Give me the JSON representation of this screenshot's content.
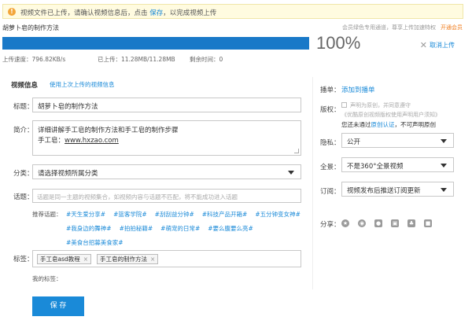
{
  "notice": {
    "prefix": "视频文件已上传，请确认视频信息后，点击",
    "save_link": "保存",
    "suffix": "，以完成视频上传"
  },
  "upload": {
    "file_name": "胡萝卜皂的制作方法",
    "vip_hint": "会员绿色专用通道，尊享上传加速特权",
    "vip_link": "开通会员",
    "progress": 100,
    "percent_label": "100%",
    "cancel_label": "取消上传",
    "speed_label": "上传速度：",
    "speed_value": "796.82KB/s",
    "uploaded_label": "已上传：",
    "uploaded_value": "11.28MB/11.28MB",
    "remaining_label": "剩余时间：",
    "remaining_value": "0"
  },
  "video_info": {
    "section_title": "视频信息",
    "last_info_link": "使用上次上传的视频信息",
    "title_label": "标题：",
    "title_value": "胡萝卜皂的制作方法",
    "desc_label": "简介：",
    "desc_line1": "详细讲解手工皂的制作方法和手工皂的制作步骤",
    "desc_line2_prefix": "手工皂：",
    "desc_line2_link": "www.hxzao.com",
    "category_label": "分类：",
    "category_value": "请选择视频所属分类",
    "topic_label": "话题：",
    "topic_placeholder": "话题是同一主题的视频集合，如视频内容与话题不匹配，将不能成功进入话题",
    "rec_label": "推荐话题：",
    "rec_topics_row1": [
      "#天生爱分享#",
      "#篮客学院#",
      "#刮刮益分钟#",
      "#科技产品开箱#",
      "#五分钟变女神#"
    ],
    "rec_topics_row2": [
      "#我身边的舞神#",
      "#拍拍秘籍#",
      "#萌宠的日常#",
      "#要么腹要么亮#"
    ],
    "rec_topics_row3": [
      "#美食台招募美食家#"
    ],
    "tags_label": "标签：",
    "tags": [
      "手工皂asd教程",
      "手工皂的制作方法"
    ],
    "my_tags_label": "我的标签：",
    "save_button": "保 存"
  },
  "side": {
    "playlist_label": "播单：",
    "playlist_link": "添加到播单",
    "copyright_label": "版权：",
    "copyright_check": "声明为原创，并同意遵守",
    "copyright_agreement": "《优酷原创视频版权使用声明用户须知》",
    "copyright_note_prefix": "您还未通过",
    "copyright_note_link": "原创认证",
    "copyright_note_suffix": "，不可声明原创",
    "privacy_label": "隐私：",
    "privacy_value": "公开",
    "panorama_label": "全景：",
    "panorama_value": "不是360°全景视频",
    "subscribe_label": "订阅：",
    "subscribe_value": "视频发布后推送订阅更新",
    "share_label": "分享："
  }
}
